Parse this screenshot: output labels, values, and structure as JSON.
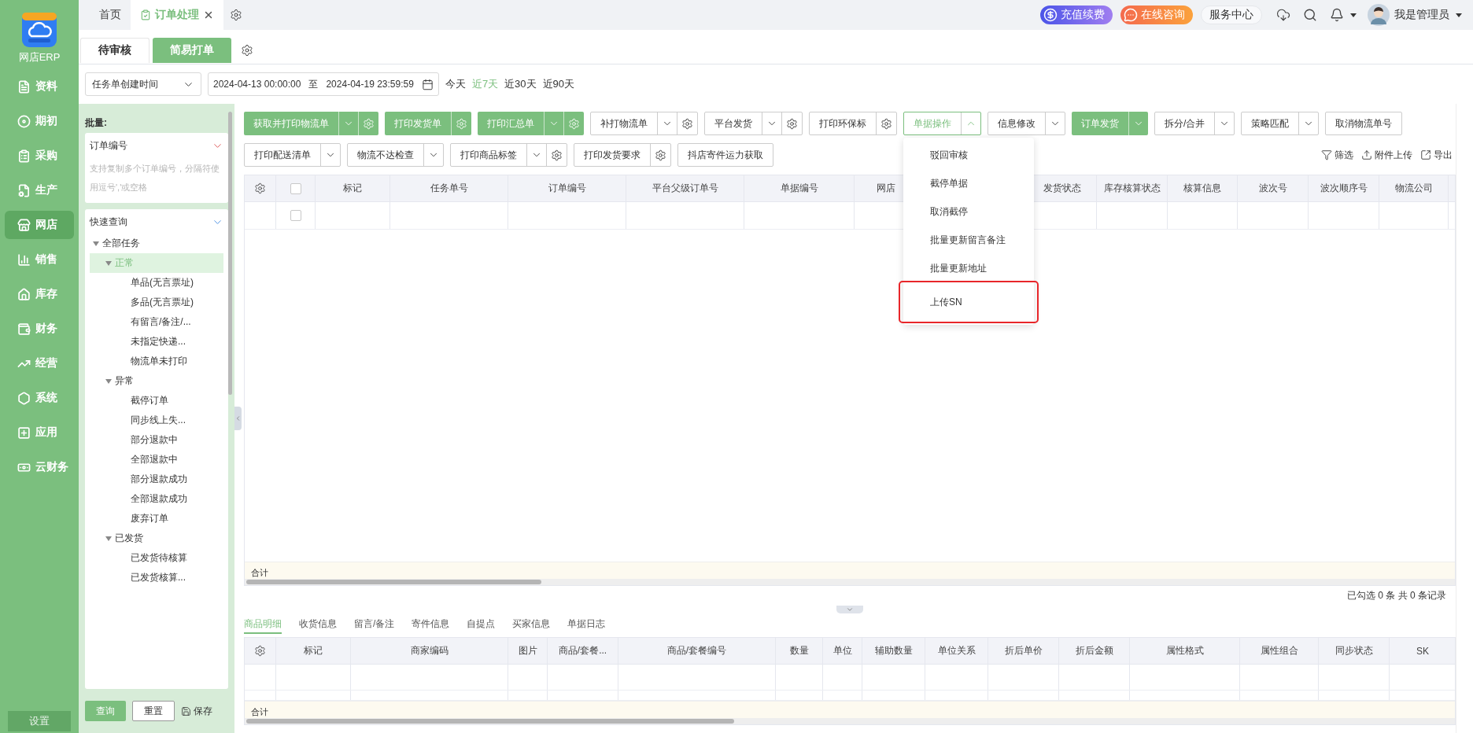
{
  "nav": {
    "logo_label": "网店ERP",
    "items": [
      {
        "label": "资料",
        "selected": false
      },
      {
        "label": "期初",
        "selected": false
      },
      {
        "label": "采购",
        "selected": false
      },
      {
        "label": "生产",
        "selected": false
      },
      {
        "label": "网店",
        "selected": true
      },
      {
        "label": "销售",
        "selected": false
      },
      {
        "label": "库存",
        "selected": false
      },
      {
        "label": "财务",
        "selected": false
      },
      {
        "label": "经营",
        "selected": false
      },
      {
        "label": "系统",
        "selected": false
      },
      {
        "label": "应用",
        "selected": false
      },
      {
        "label": "云财务",
        "selected": false
      }
    ],
    "settings": "设置"
  },
  "top_tabs": [
    {
      "label": "首页",
      "selected": false,
      "closable": false
    },
    {
      "label": "订单处理",
      "selected": true,
      "closable": true
    }
  ],
  "top_actions": [
    {
      "kind": "recharge",
      "label": "充值续费"
    },
    {
      "kind": "consult",
      "label": "在线咨询"
    },
    {
      "kind": "service",
      "label": "服务中心"
    }
  ],
  "user": {
    "name": "我是管理员"
  },
  "sub_tabs": [
    {
      "label": "待审核",
      "selected": false
    },
    {
      "label": "简易打单",
      "selected": true
    }
  ],
  "filter": {
    "date_field": "任务单创建时间",
    "start": "2024-04-13 00:00:00",
    "separator": "至",
    "end": "2024-04-19 23:59:59",
    "quick_ranges": [
      {
        "label": "今天",
        "selected": false
      },
      {
        "label": "近7天",
        "selected": true
      },
      {
        "label": "近30天",
        "selected": false
      },
      {
        "label": "近90天",
        "selected": false
      }
    ]
  },
  "side_panel": {
    "batch_label": "批量:",
    "batch_field": "订单编号",
    "batch_placeholder": "支持复制多个订单编号，分隔符使用逗号','或空格",
    "quick_query": "快速查询",
    "tree": [
      {
        "label": "全部任务",
        "expanded": true,
        "selected": false,
        "children": [
          {
            "label": "正常",
            "expanded": true,
            "selected": true,
            "children": [
              {
                "label": "单品(无言票址)",
                "selected": false
              },
              {
                "label": "多品(无言票址)",
                "selected": false
              },
              {
                "label": "有留言/备注/...",
                "selected": false
              },
              {
                "label": "未指定快递...",
                "selected": false
              },
              {
                "label": "物流单未打印",
                "selected": false
              }
            ]
          },
          {
            "label": "异常",
            "expanded": true,
            "selected": false,
            "children": [
              {
                "label": "截停订单",
                "selected": false
              },
              {
                "label": "同步线上失...",
                "selected": false
              },
              {
                "label": "部分退款中",
                "selected": false
              },
              {
                "label": "全部退款中",
                "selected": false
              },
              {
                "label": "部分退款成功",
                "selected": false
              },
              {
                "label": "全部退款成功",
                "selected": false
              },
              {
                "label": "废弃订单",
                "selected": false
              }
            ]
          },
          {
            "label": "已发货",
            "expanded": true,
            "selected": false,
            "children": [
              {
                "label": "已发货待核算",
                "selected": false
              },
              {
                "label": "已发货核算...",
                "selected": false
              }
            ]
          }
        ]
      }
    ],
    "buttons": {
      "query": "查询",
      "reset": "重置",
      "save": "保存"
    }
  },
  "toolbar_rows": [
    [
      {
        "label": "获取并打印物流单",
        "primary": true,
        "caret": true,
        "gear": true,
        "open": false
      },
      {
        "label": "打印发货单",
        "primary": true,
        "caret": false,
        "gear": true,
        "open": false
      },
      {
        "label": "打印汇总单",
        "primary": true,
        "caret": true,
        "gear": true,
        "open": false
      },
      {
        "label": "补打物流单",
        "primary": false,
        "caret": true,
        "gear": true,
        "open": false
      },
      {
        "label": "平台发货",
        "primary": false,
        "caret": true,
        "gear": true,
        "open": false
      },
      {
        "label": "打印环保标",
        "primary": false,
        "caret": false,
        "gear": true,
        "open": false
      },
      {
        "label": "单据操作",
        "primary": false,
        "caret": true,
        "gear": false,
        "open": true
      },
      {
        "label": "信息修改",
        "primary": false,
        "caret": true,
        "gear": false,
        "open": false
      },
      {
        "label": "订单发货",
        "primary": true,
        "caret": true,
        "gear": false,
        "open": false
      },
      {
        "label": "拆分/合并",
        "primary": false,
        "caret": true,
        "gear": false,
        "open": false
      },
      {
        "label": "策略匹配",
        "primary": false,
        "caret": true,
        "gear": false,
        "open": false
      },
      {
        "label": "取消物流单号",
        "primary": false,
        "caret": false,
        "gear": false,
        "open": false
      }
    ],
    [
      {
        "label": "打印配送清单",
        "primary": false,
        "caret": true,
        "gear": false,
        "open": false
      },
      {
        "label": "物流不达检查",
        "primary": false,
        "caret": true,
        "gear": false,
        "open": false
      },
      {
        "label": "打印商品标签",
        "primary": false,
        "caret": true,
        "gear": true,
        "open": false
      },
      {
        "label": "打印发货要求",
        "primary": false,
        "caret": false,
        "gear": true,
        "open": false
      },
      {
        "label": "抖店寄件运力获取",
        "primary": false,
        "caret": false,
        "gear": false,
        "open": false
      }
    ]
  ],
  "dropdown_menu": {
    "items": [
      {
        "label": "驳回审核",
        "highlighted": false
      },
      {
        "label": "截停单据",
        "highlighted": false
      },
      {
        "label": "取消截停",
        "highlighted": false
      },
      {
        "label": "批量更新留言备注",
        "highlighted": false
      },
      {
        "label": "批量更新地址",
        "highlighted": false
      },
      {
        "label": "上传SN",
        "highlighted": true
      }
    ]
  },
  "table_tools": [
    {
      "kind": "filter",
      "label": "筛选"
    },
    {
      "kind": "upload",
      "label": "附件上传"
    },
    {
      "kind": "export",
      "label": "导出"
    }
  ],
  "table": {
    "header_checked": false,
    "columns": [
      "标记",
      "任务单号",
      "订单编号",
      "平台父级订单号",
      "单据编号",
      "网店",
      "发货状态",
      "库存核算状态",
      "核算信息",
      "波次号",
      "波次顺序号",
      "物流公司"
    ],
    "rows": [
      {
        "checked": false
      }
    ],
    "total_label": "合计",
    "summary": "已勾选 0 条 共 0 条记录"
  },
  "detail": {
    "tabs": [
      {
        "label": "商品明细",
        "selected": true
      },
      {
        "label": "收货信息",
        "selected": false
      },
      {
        "label": "留言/备注",
        "selected": false
      },
      {
        "label": "寄件信息",
        "selected": false
      },
      {
        "label": "自提点",
        "selected": false
      },
      {
        "label": "买家信息",
        "selected": false
      },
      {
        "label": "单据日志",
        "selected": false
      }
    ],
    "columns": [
      "标记",
      "商家编码",
      "图片",
      "商品/套餐...",
      "商品/套餐编号",
      "数量",
      "单位",
      "辅助数量",
      "单位关系",
      "折后单价",
      "折后金额",
      "属性格式",
      "属性组合",
      "同步状态",
      "SK"
    ],
    "total_label": "合计"
  }
}
